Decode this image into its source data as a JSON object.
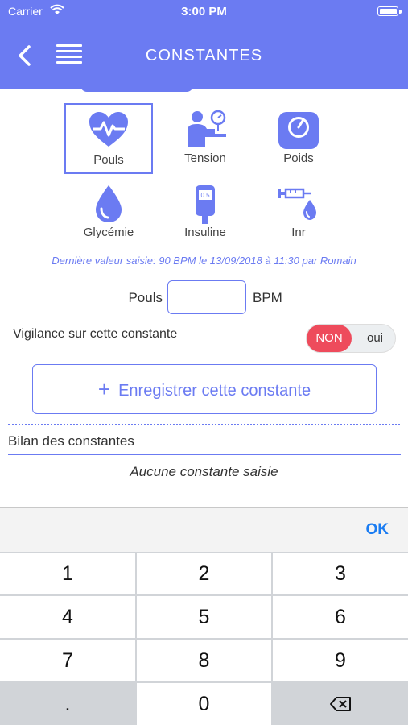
{
  "status": {
    "carrier": "Carrier",
    "time": "3:00 PM"
  },
  "nav": {
    "title": "CONSTANTES"
  },
  "tabs": [
    {
      "label": "Pouls",
      "icon": "heart-pulse-icon"
    },
    {
      "label": "Tension",
      "icon": "blood-pressure-icon"
    },
    {
      "label": "Poids",
      "icon": "scale-icon"
    },
    {
      "label": "Glycémie",
      "icon": "blood-drop-icon"
    },
    {
      "label": "Insuline",
      "icon": "glucometer-icon"
    },
    {
      "label": "Inr",
      "icon": "syringe-drop-icon"
    }
  ],
  "last_value": "Dernière valeur saisie: 90 BPM le 13/09/2018 à 11:30 par Romain",
  "pouls": {
    "label": "Pouls",
    "value": "",
    "unit": "BPM"
  },
  "vigilance": {
    "label": "Vigilance sur cette constante",
    "non": "NON",
    "oui": "oui",
    "selected": "NON"
  },
  "save_button": {
    "plus": "+",
    "label": "Enregistrer cette constante"
  },
  "bilan": {
    "title": "Bilan des constantes",
    "empty": "Aucune constante saisie"
  },
  "keyboard": {
    "ok": "OK",
    "keys": [
      "1",
      "2",
      "3",
      "4",
      "5",
      "6",
      "7",
      "8",
      "9",
      ".",
      "0"
    ]
  },
  "colors": {
    "accent": "#6b7bf2",
    "non": "#ee4b5c",
    "ok": "#1a7cf2"
  }
}
